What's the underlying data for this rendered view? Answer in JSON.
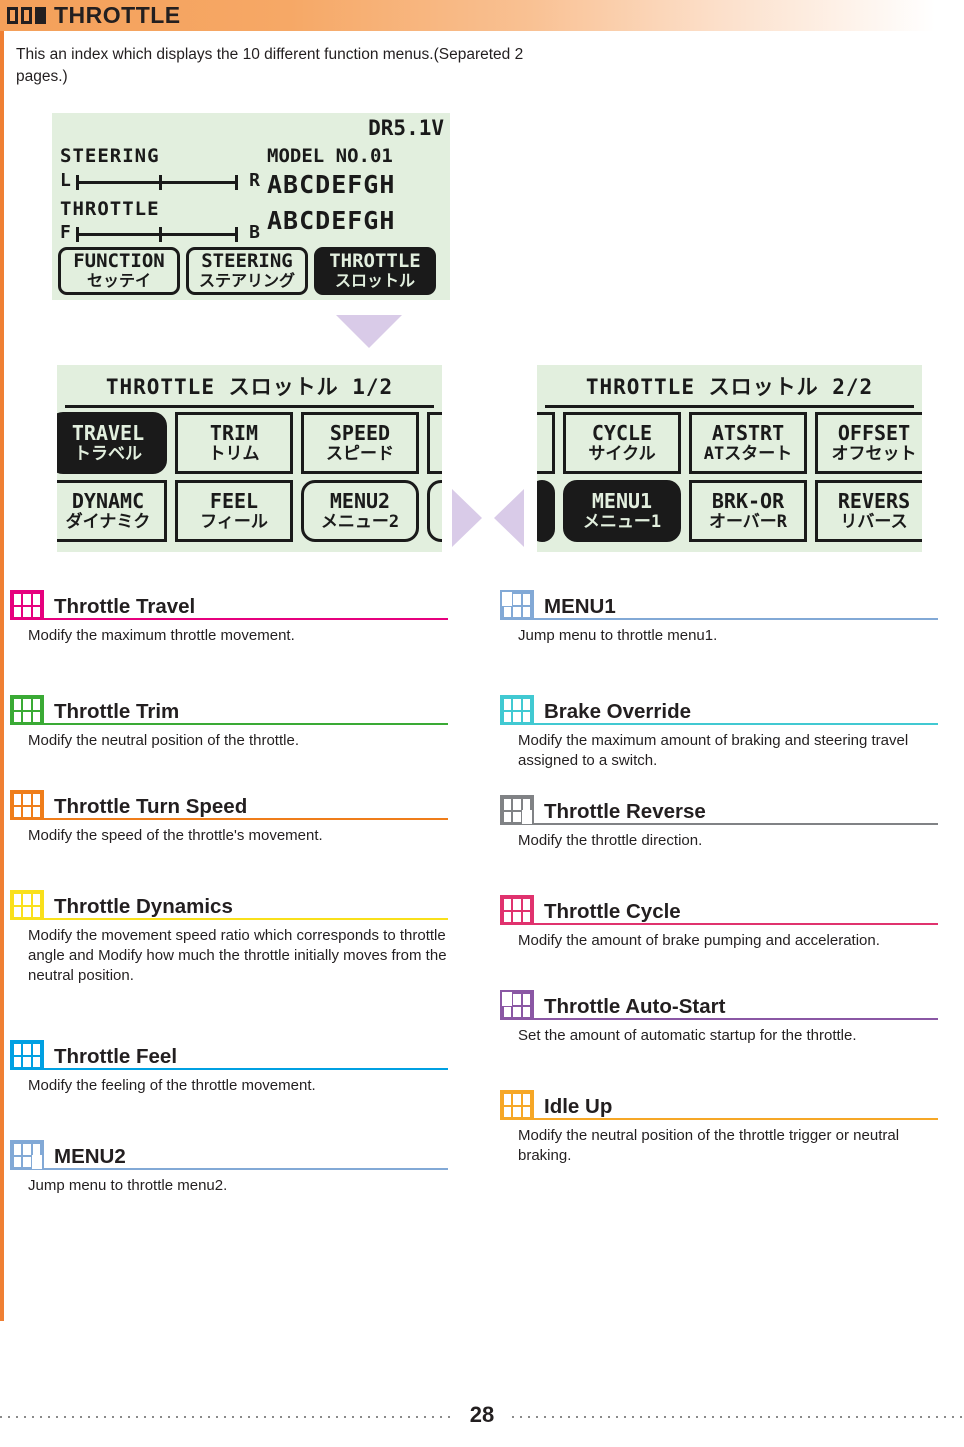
{
  "header": {
    "title": "THROTTLE",
    "squares": [
      "hollow",
      "hollow",
      "filled"
    ],
    "gradient_start": "#f4a05a",
    "gradient_end": "#ffffff"
  },
  "intro": "This an index which displays the 10 different function menus.(Separeted 2 pages.)",
  "spine_color": "#ef7f33",
  "lcd_main": {
    "voltage": "DR5.1V",
    "model_no": "MODEL NO.01",
    "steering_label": "STEERING",
    "steering_left": "L",
    "steering_right": "R",
    "throttle_label": "THROTTLE",
    "throttle_left": "F",
    "throttle_right": "B",
    "model_name_1": "ABCDEFGH",
    "model_name_2": "ABCDEFGH",
    "buttons": [
      {
        "en": "FUNCTION",
        "jp": "セッテイ",
        "selected": false
      },
      {
        "en": "STEERING",
        "jp": "ステアリング",
        "selected": false
      },
      {
        "en": "THROTTLE",
        "jp": "スロットル",
        "selected": true
      }
    ]
  },
  "lcd_menu_1": {
    "title": "THROTTLE スロットル 1/2",
    "buttons_row1": [
      {
        "en": "TRAVEL",
        "jp": "トラベル",
        "selected": true
      },
      {
        "en": "TRIM",
        "jp": "トリム",
        "selected": false
      },
      {
        "en": "SPEED",
        "jp": "スピード",
        "selected": false
      }
    ],
    "buttons_row2": [
      {
        "en": "DYNAMC",
        "jp": "ダイナミク",
        "selected": false
      },
      {
        "en": "FEEL",
        "jp": "フィール",
        "selected": false
      },
      {
        "en": "MENU2",
        "jp": "メニュー2",
        "selected": false
      }
    ]
  },
  "lcd_menu_2": {
    "title": "THROTTLE スロットル 2/2",
    "buttons_row1": [
      {
        "en": "CYCLE",
        "jp": "サイクル",
        "selected": false
      },
      {
        "en": "ATSTRT",
        "jp": "ATスタート",
        "selected": false
      },
      {
        "en": "OFFSET",
        "jp": "オフセット",
        "selected": false
      }
    ],
    "buttons_row2": [
      {
        "en": "MENU1",
        "jp": "メニュー1",
        "selected": true
      },
      {
        "en": "BRK-OR",
        "jp": "オーバーR",
        "selected": false
      },
      {
        "en": "REVERS",
        "jp": "リバース",
        "selected": false
      }
    ]
  },
  "arrows": {
    "down_color": "#d9cbe8",
    "side_color": "#d9cbe8"
  },
  "entries_left": [
    {
      "name": "Throttle Travel",
      "desc": "Modify the maximum throttle movement.",
      "color": "#e6007e",
      "icon": "menu-tile-icon",
      "variant": "plain"
    },
    {
      "name": "Throttle Trim",
      "desc": "Modify the neutral position of the throttle.",
      "color": "#3aaa35",
      "icon": "menu-tile-icon",
      "variant": "plain"
    },
    {
      "name": "Throttle Turn Speed",
      "desc": "Modify the speed of the throttle's movement.",
      "color": "#ef7d1a",
      "icon": "menu-tile-icon",
      "variant": "plain"
    },
    {
      "name": "Throttle Dynamics",
      "desc": "Modify the movement speed ratio which corresponds to throttle angle and Modify how much the throttle initially moves from the neutral position.",
      "color": "#f9e01b",
      "icon": "menu-tile-icon",
      "variant": "plain"
    },
    {
      "name": "Throttle Feel",
      "desc": "Modify the feeling of the throttle movement.",
      "color": "#00a0e2",
      "icon": "menu-tile-icon",
      "variant": "plain"
    },
    {
      "name": "MENU2",
      "desc": "Jump menu to throttle menu2.",
      "color": "#82a9d6",
      "icon": "menu-tile-icon",
      "variant": "big-bottom-right"
    }
  ],
  "entries_right": [
    {
      "name": "MENU1",
      "desc": "Jump menu to throttle menu1.",
      "color": "#82a9d6",
      "icon": "menu-tile-icon",
      "variant": "big-top-left"
    },
    {
      "name": "Brake Override",
      "desc": "Modify the maximum amount of braking and steering travel assigned to a switch.",
      "color": "#41c9d2",
      "icon": "menu-tile-icon",
      "variant": "plain"
    },
    {
      "name": "Throttle Reverse",
      "desc": "Modify the throttle direction.",
      "color": "#808285",
      "icon": "menu-tile-icon",
      "variant": "big-bottom-right"
    },
    {
      "name": "Throttle Cycle",
      "desc": "Modify the amount of brake pumping and acceleration.",
      "color": "#e0326e",
      "icon": "menu-tile-icon",
      "variant": "plain"
    },
    {
      "name": "Throttle Auto-Start",
      "desc": "Set the amount of automatic startup for the throttle.",
      "color": "#8a57a4",
      "icon": "menu-tile-icon",
      "variant": "big-top-left"
    },
    {
      "name": "Idle Up",
      "desc": "Modify the neutral position of the throttle trigger or neutral braking.",
      "color": "#f6a726",
      "icon": "menu-tile-icon",
      "variant": "plain"
    }
  ],
  "footer": {
    "page_number": "28"
  }
}
